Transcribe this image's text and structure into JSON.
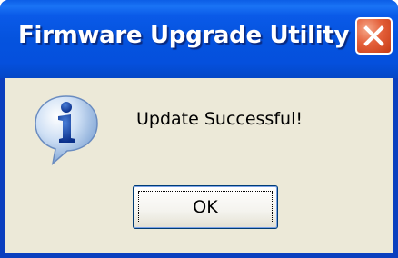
{
  "window": {
    "title": "Firmware Upgrade Utility",
    "close_icon": "close-icon"
  },
  "dialog": {
    "icon": "information-icon",
    "message": "Update Successful!",
    "ok_label": "OK"
  },
  "colors": {
    "titlebar": "#0553de",
    "client_background": "#ece9d8",
    "close_button": "#e4603a"
  }
}
